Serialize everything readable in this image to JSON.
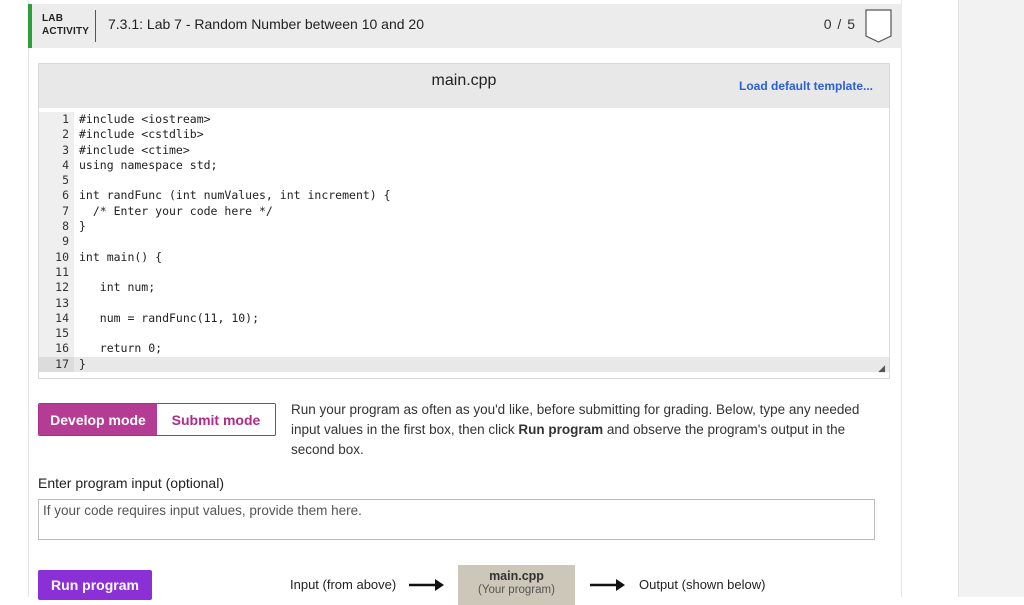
{
  "header": {
    "lab_line1": "LAB",
    "lab_line2": "ACTIVITY",
    "title": "7.3.1: Lab 7 - Random Number between 10 and 20",
    "score": "0 / 5",
    "accent_color": "#2e9e3c"
  },
  "editor": {
    "filename": "main.cpp",
    "load_template": "Load default template...",
    "lines": [
      {
        "n": "1",
        "text": "#include <iostream>"
      },
      {
        "n": "2",
        "text": "#include <cstdlib>"
      },
      {
        "n": "3",
        "text": "#include <ctime>"
      },
      {
        "n": "4",
        "text": "using namespace std;"
      },
      {
        "n": "5",
        "text": ""
      },
      {
        "n": "6",
        "text": "int randFunc (int numValues, int increment) {"
      },
      {
        "n": "7",
        "text": "  /* Enter your code here */"
      },
      {
        "n": "8",
        "text": "}"
      },
      {
        "n": "9",
        "text": ""
      },
      {
        "n": "10",
        "text": "int main() {"
      },
      {
        "n": "11",
        "text": ""
      },
      {
        "n": "12",
        "text": "   int num;"
      },
      {
        "n": "13",
        "text": ""
      },
      {
        "n": "14",
        "text": "   num = randFunc(11, 10);"
      },
      {
        "n": "15",
        "text": ""
      },
      {
        "n": "16",
        "text": "   return 0;"
      },
      {
        "n": "17",
        "text": "}"
      }
    ]
  },
  "modes": {
    "develop": "Develop mode",
    "submit": "Submit mode",
    "active_color": "#b53c94"
  },
  "instructions": {
    "part1": "Run your program as often as you'd like, before submitting for grading. Below, type any needed input values in the first box, then click ",
    "bold": "Run program",
    "part2": " and observe the program's output in the second box."
  },
  "input": {
    "label": "Enter program input (optional)",
    "placeholder": "If your code requires input values, provide them here."
  },
  "run": {
    "button": "Run program",
    "button_color": "#8b2fd6",
    "input_label": "Input (from above)",
    "box_name": "main.cpp",
    "box_sub": "(Your program)",
    "output_label": "Output (shown below)"
  }
}
